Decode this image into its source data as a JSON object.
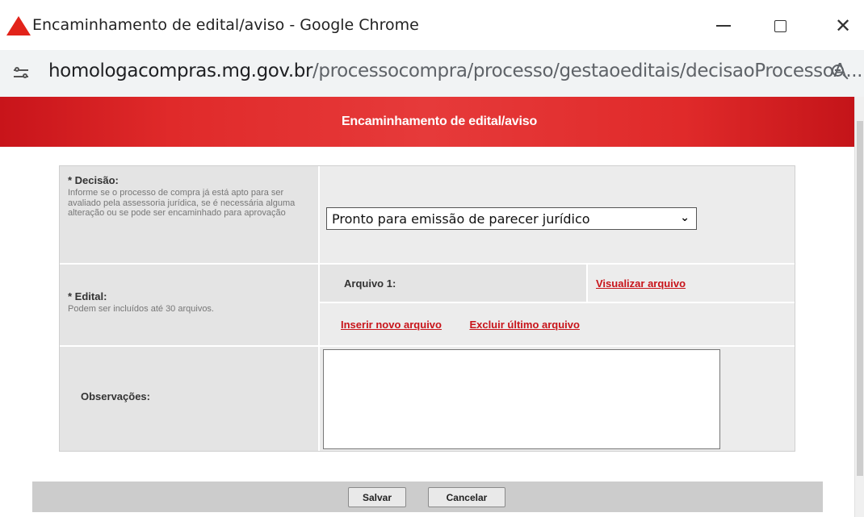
{
  "window": {
    "title": "Encaminhamento de edital/aviso - Google Chrome",
    "app_icon": "red-triangle-logo-icon",
    "controls": {
      "minimize_icon": "minimize-icon",
      "maximize_icon": "maximize-icon",
      "close_symbol": "✕"
    }
  },
  "address_bar": {
    "host": "homologacompras.mg.gov.br",
    "path": "/processocompra/processo/gestaoeditais/decisaoProcessoA...",
    "site_info_icon": "tune-icon",
    "zoom_icon": "zoom-out-icon"
  },
  "page": {
    "header_title": "Encaminhamento de edital/aviso",
    "accent_color": "#e02a2a"
  },
  "form": {
    "decisao": {
      "label": "* Decisão:",
      "help": "Informe se o processo de compra já está apto para ser avaliado pela assessoria jurídica, se é necessária alguma alteração ou se pode ser encaminhado para aprovação",
      "selected": "Pronto para emissão de parecer jurídico"
    },
    "edital": {
      "label": "* Edital:",
      "help": "Podem ser incluídos até 30 arquivos.",
      "file_label": "Arquivo 1:",
      "view_link": "Visualizar arquivo",
      "insert_link": "Inserir novo arquivo",
      "delete_link": "Excluir último arquivo"
    },
    "observacoes": {
      "label": "Observações:",
      "value": ""
    }
  },
  "footer": {
    "save_label": "Salvar",
    "cancel_label": "Cancelar"
  }
}
